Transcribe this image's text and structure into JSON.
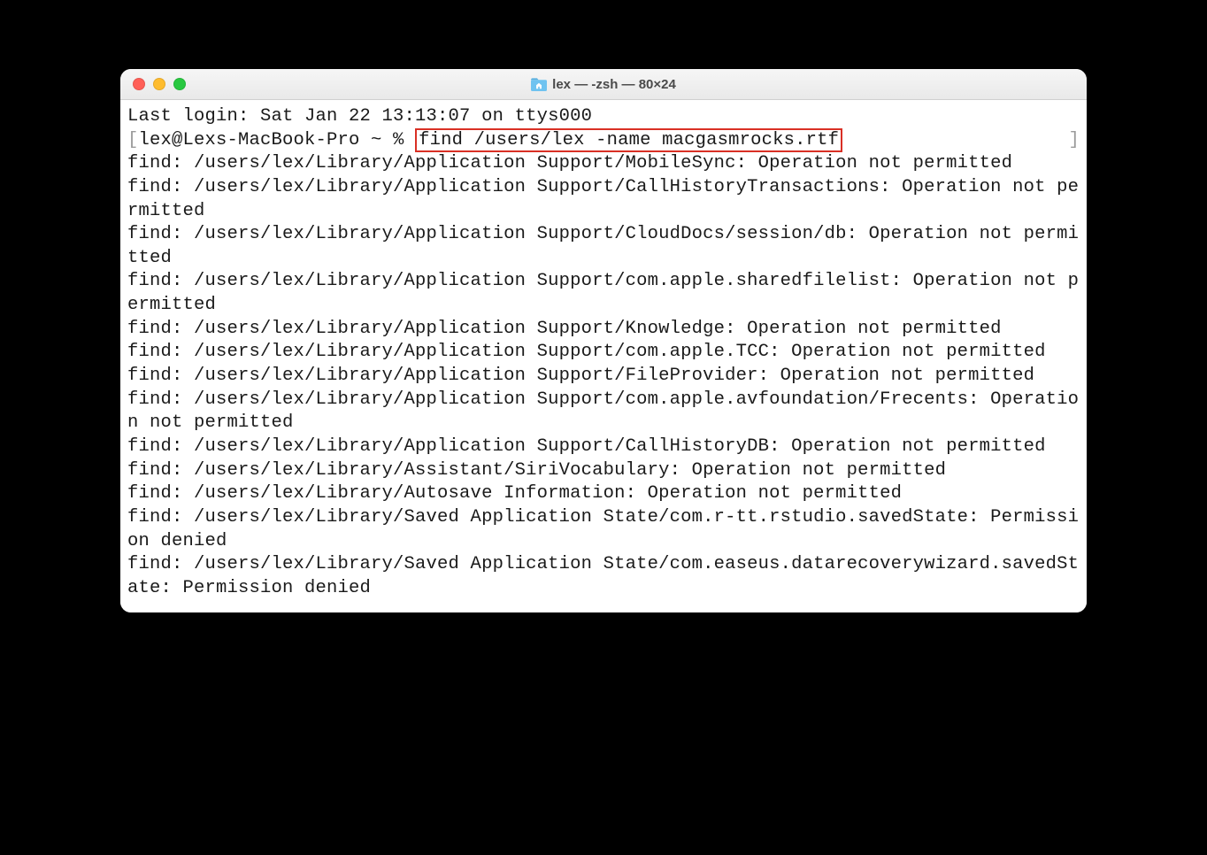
{
  "window": {
    "title": "lex — -zsh — 80×24"
  },
  "terminal": {
    "last_login": "Last login: Sat Jan 22 13:13:07 on ttys000",
    "prompt_bracket_open": "[",
    "prompt": "lex@Lexs-MacBook-Pro ~ % ",
    "command": "find /users/lex -name macgasmrocks.rtf",
    "prompt_bracket_close": "]",
    "output_lines": [
      "find: /users/lex/Library/Application Support/MobileSync: Operation not permitted",
      "find: /users/lex/Library/Application Support/CallHistoryTransactions: Operation not permitted",
      "find: /users/lex/Library/Application Support/CloudDocs/session/db: Operation not permitted",
      "find: /users/lex/Library/Application Support/com.apple.sharedfilelist: Operation not permitted",
      "find: /users/lex/Library/Application Support/Knowledge: Operation not permitted",
      "find: /users/lex/Library/Application Support/com.apple.TCC: Operation not permitted",
      "find: /users/lex/Library/Application Support/FileProvider: Operation not permitted",
      "find: /users/lex/Library/Application Support/com.apple.avfoundation/Frecents: Operation not permitted",
      "find: /users/lex/Library/Application Support/CallHistoryDB: Operation not permitted",
      "find: /users/lex/Library/Assistant/SiriVocabulary: Operation not permitted",
      "find: /users/lex/Library/Autosave Information: Operation not permitted",
      "find: /users/lex/Library/Saved Application State/com.r-tt.rstudio.savedState: Permission denied",
      "find: /users/lex/Library/Saved Application State/com.easeus.datarecoverywizard.savedState: Permission denied"
    ]
  }
}
